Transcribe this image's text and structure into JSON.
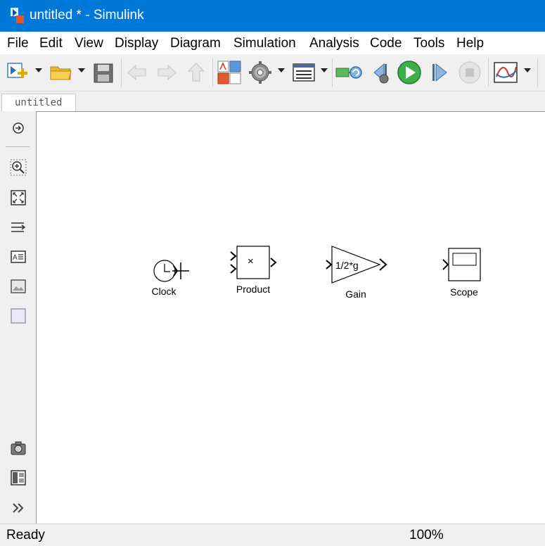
{
  "window": {
    "title": "untitled * - Simulink"
  },
  "menu": [
    "File",
    "Edit",
    "View",
    "Display",
    "Diagram",
    "Simulation",
    "Analysis",
    "Code",
    "Tools",
    "Help"
  ],
  "toolbar": {
    "icons": [
      "new-model-icon",
      "open-folder-icon",
      "save-icon",
      "back-arrow-icon",
      "forward-arrow-icon",
      "up-arrow-icon",
      "library-browser-icon",
      "model-settings-gear-icon",
      "model-explorer-icon",
      "update-diagram-icon",
      "step-back-icon",
      "run-icon",
      "step-forward-icon",
      "stop-icon",
      "scope-viewer-icon"
    ]
  },
  "tab": {
    "label": "untitled"
  },
  "palette": {
    "icons": [
      "hide-explorer-bar-icon",
      "zoom-icon",
      "fit-to-view-icon",
      "signal-lines-icon",
      "annotation-icon",
      "image-icon",
      "area-icon",
      "screenshot-camera-icon",
      "model-browser-icon",
      "expand-chevrons-icon"
    ]
  },
  "blocks": {
    "clock": {
      "label": "Clock"
    },
    "product": {
      "label": "Product",
      "symbol": "×"
    },
    "gain": {
      "label": "Gain",
      "value": "1/2*g"
    },
    "scope": {
      "label": "Scope"
    }
  },
  "status": {
    "text": "Ready",
    "zoom": "100%"
  }
}
